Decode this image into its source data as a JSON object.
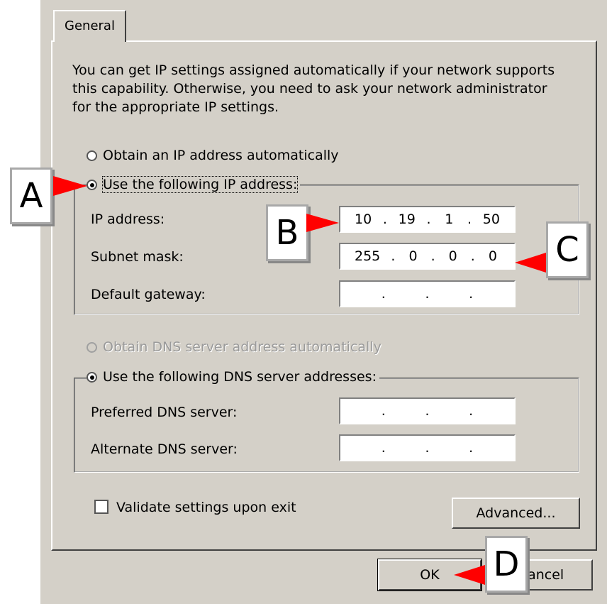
{
  "tab": {
    "label": "General"
  },
  "intro_text": "You can get IP settings assigned automatically if your network supports this capability. Otherwise, you need to ask your network administrator for the appropriate IP settings.",
  "ip_section": {
    "auto_label": "Obtain an IP address automatically",
    "manual_label": "Use the following IP address:",
    "selected": "manual",
    "fields": [
      {
        "label": "IP address:",
        "octets": [
          "10",
          "19",
          "1",
          "50"
        ]
      },
      {
        "label": "Subnet mask:",
        "octets": [
          "255",
          "0",
          "0",
          "0"
        ]
      },
      {
        "label": "Default gateway:",
        "octets": [
          "",
          "",
          "",
          ""
        ]
      }
    ]
  },
  "dns_section": {
    "auto_label": "Obtain DNS server address automatically",
    "manual_label": "Use the following DNS server addresses:",
    "selected": "manual",
    "fields": [
      {
        "label": "Preferred DNS server:",
        "octets": [
          "",
          "",
          "",
          ""
        ]
      },
      {
        "label": "Alternate DNS server:",
        "octets": [
          "",
          "",
          "",
          ""
        ]
      }
    ]
  },
  "validate_label": "Validate settings upon exit",
  "validate_checked": false,
  "buttons": {
    "advanced": "Advanced...",
    "ok": "OK",
    "cancel": "Cancel"
  },
  "callouts": {
    "a": "A",
    "b": "B",
    "c": "C",
    "d": "D"
  },
  "colors": {
    "dialog_bg": "#d4d0c8",
    "callout_arrow": "#ff0000"
  }
}
